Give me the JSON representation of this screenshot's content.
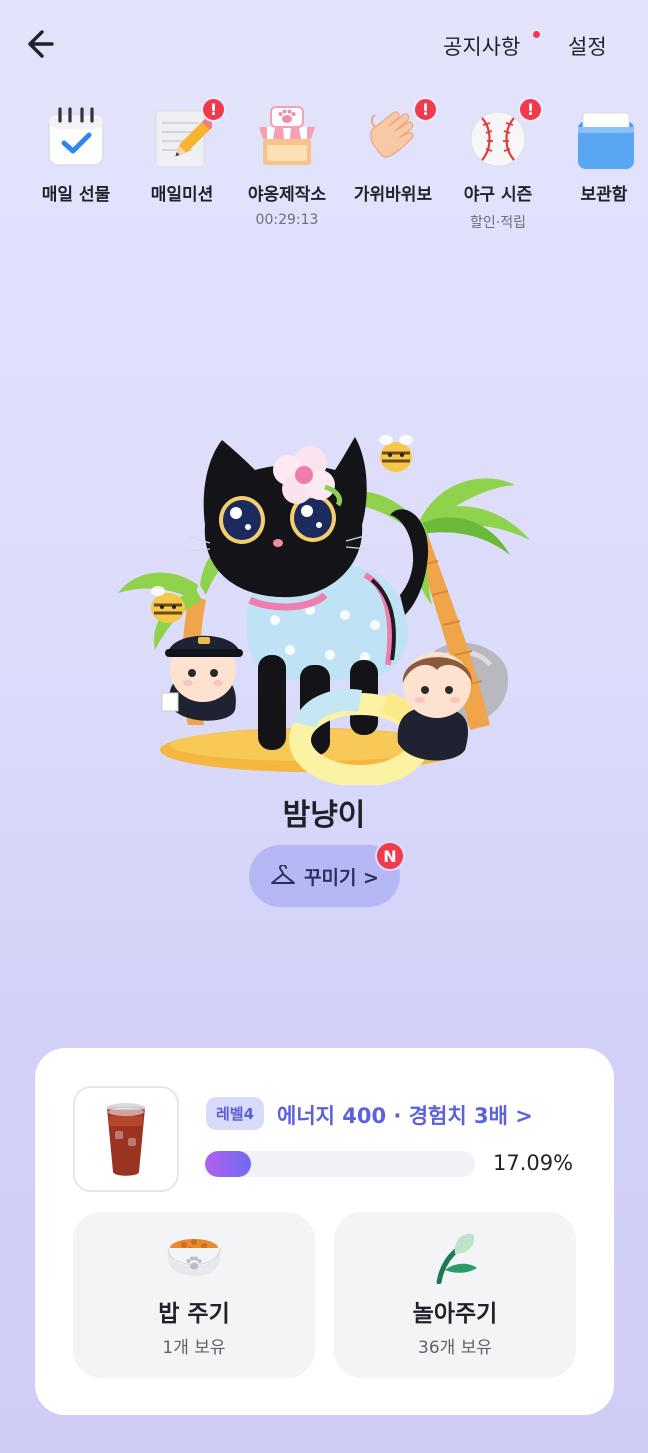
{
  "header": {
    "back_icon": "arrow-left-icon",
    "notice_label": "공지사항",
    "settings_label": "설정"
  },
  "menu": [
    {
      "label": "매일 선물",
      "icon": "calendar-check-icon",
      "sub": "",
      "alert": ""
    },
    {
      "label": "매일미션",
      "icon": "memo-pencil-icon",
      "sub": "",
      "alert": "!"
    },
    {
      "label": "야옹제작소",
      "icon": "paw-shop-icon",
      "sub": "00:29:13",
      "alert": ""
    },
    {
      "label": "가위바위보",
      "icon": "waving-hand-icon",
      "sub": "",
      "alert": "!"
    },
    {
      "label": "야구 시즌",
      "icon": "baseball-icon",
      "sub": "할인·적립",
      "alert": "!"
    },
    {
      "label": "보관함",
      "icon": "storage-box-icon",
      "sub": "",
      "alert": ""
    }
  ],
  "pet": {
    "name": "밤냥이",
    "decorate_label": "꾸미기 >",
    "new_badge": "N"
  },
  "status": {
    "level_badge": "레벨4",
    "level_info": "에너지 400 · 경험치 3배 >",
    "progress_percent": 17.09,
    "progress_text": "17.09%"
  },
  "actions": [
    {
      "title": "밥 주기",
      "sub": "1개 보유",
      "icon": "food-bowl-icon"
    },
    {
      "title": "놀아주기",
      "sub": "36개 보유",
      "icon": "leaf-toy-icon"
    }
  ],
  "colors": {
    "accent": "#5c62db",
    "alert": "#f23a4d",
    "button": "#b6b8f6"
  }
}
